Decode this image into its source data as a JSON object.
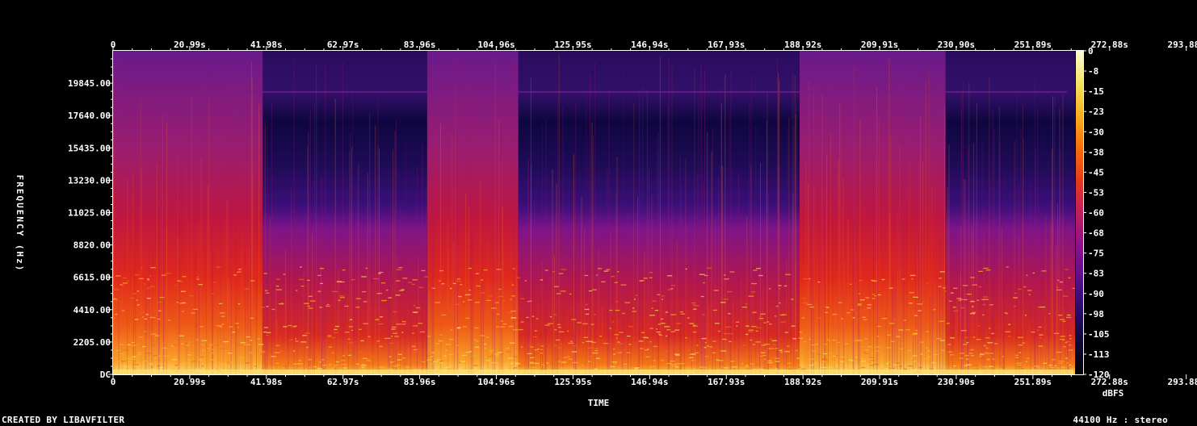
{
  "chart_data": {
    "type": "heatmap",
    "title": "",
    "xlabel": "TIME",
    "ylabel": "FREQUENCY (Hz)",
    "x_ticks": [
      "0",
      "20.99s",
      "41.98s",
      "62.97s",
      "83.96s",
      "104.96s",
      "125.95s",
      "146.94s",
      "167.93s",
      "188.92s",
      "209.91s",
      "230.90s",
      "251.89s",
      "272.88s",
      "293.88s"
    ],
    "x_tick_seconds": [
      0,
      20.99,
      41.98,
      62.97,
      83.96,
      104.96,
      125.95,
      146.94,
      167.93,
      188.92,
      209.91,
      230.9,
      251.89,
      272.88,
      293.88
    ],
    "duration_s": 315,
    "y_ticks": [
      "DC",
      "2205.00",
      "4410.00",
      "6615.00",
      "8820.00",
      "11025.00",
      "13230.00",
      "15435.00",
      "17640.00",
      "19845.00"
    ],
    "y_tick_hz": [
      0,
      2205,
      4410,
      6615,
      8820,
      11025,
      13230,
      15435,
      17640,
      19845
    ],
    "ylim": [
      0,
      22050
    ],
    "colorbar": {
      "label": "dBFS",
      "ticks": [
        "0",
        "-8",
        "-15",
        "-23",
        "-30",
        "-38",
        "-45",
        "-53",
        "-60",
        "-68",
        "-75",
        "-83",
        "-90",
        "-98",
        "-105",
        "-113",
        "-120"
      ],
      "range": [
        -120,
        0
      ],
      "colormap": [
        "#000000",
        "#0d0838",
        "#2a0b6e",
        "#5a0f8f",
        "#8e1186",
        "#c01f5c",
        "#e63a1a",
        "#f96d0a",
        "#fbad1f",
        "#f7e460",
        "#fffbd8"
      ]
    },
    "segments": [
      {
        "start_s": 0,
        "end_s": 41,
        "type": "bright"
      },
      {
        "start_s": 41,
        "end_s": 86,
        "type": "dim"
      },
      {
        "start_s": 86,
        "end_s": 111,
        "type": "bright"
      },
      {
        "start_s": 111,
        "end_s": 188,
        "type": "dim"
      },
      {
        "start_s": 188,
        "end_s": 228,
        "type": "bright"
      },
      {
        "start_s": 228,
        "end_s": 314,
        "type": "dim"
      }
    ]
  },
  "footer": {
    "credit": "CREATED BY LIBAVFILTER",
    "format": "44100 Hz : stereo"
  }
}
